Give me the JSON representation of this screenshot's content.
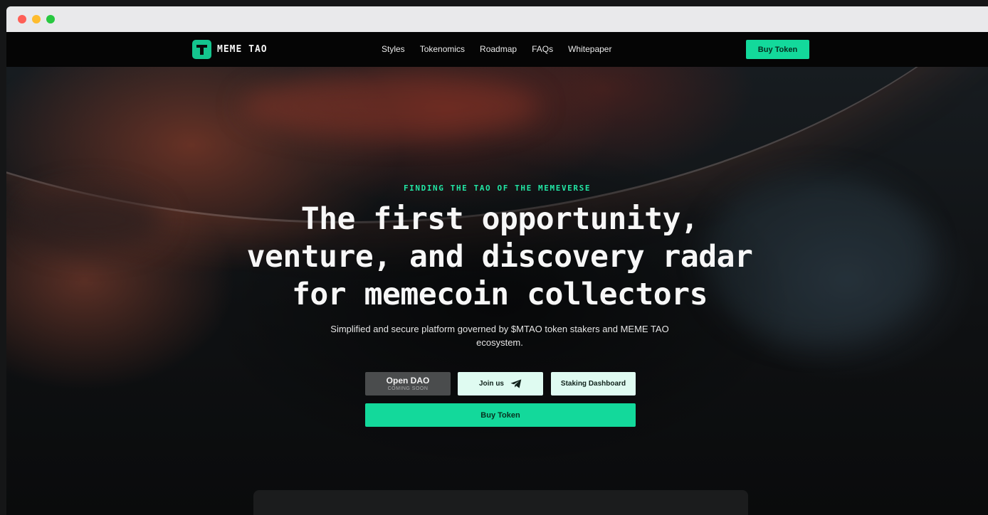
{
  "nav": {
    "brand": "MEME TAO",
    "links": [
      "Styles",
      "Tokenomics",
      "Roadmap",
      "FAQs",
      "Whitepaper"
    ],
    "buy_label": "Buy Token"
  },
  "hero": {
    "eyebrow": "FINDING THE TAO OF THE MEMEVERSE",
    "headline_lines": [
      "The first opportunity,",
      "venture, and discovery radar",
      "for memecoin collectors"
    ],
    "subtitle_lines": [
      "Simplified and secure platform governed by $MTAO token stakers and MEME TAO",
      "ecosystem."
    ],
    "buttons": {
      "open_dao": "Open DAO",
      "open_dao_status": "COMING SOON",
      "join_us": "Join us",
      "join_us_icon": "telegram-icon",
      "staking": "Staking Dashboard",
      "buy": "Buy Token"
    }
  },
  "colors": {
    "accent": "#13d99b",
    "eyebrow": "#22e6a4",
    "light_button": "#dffbf1",
    "disabled_button": "#4a4c4d"
  }
}
